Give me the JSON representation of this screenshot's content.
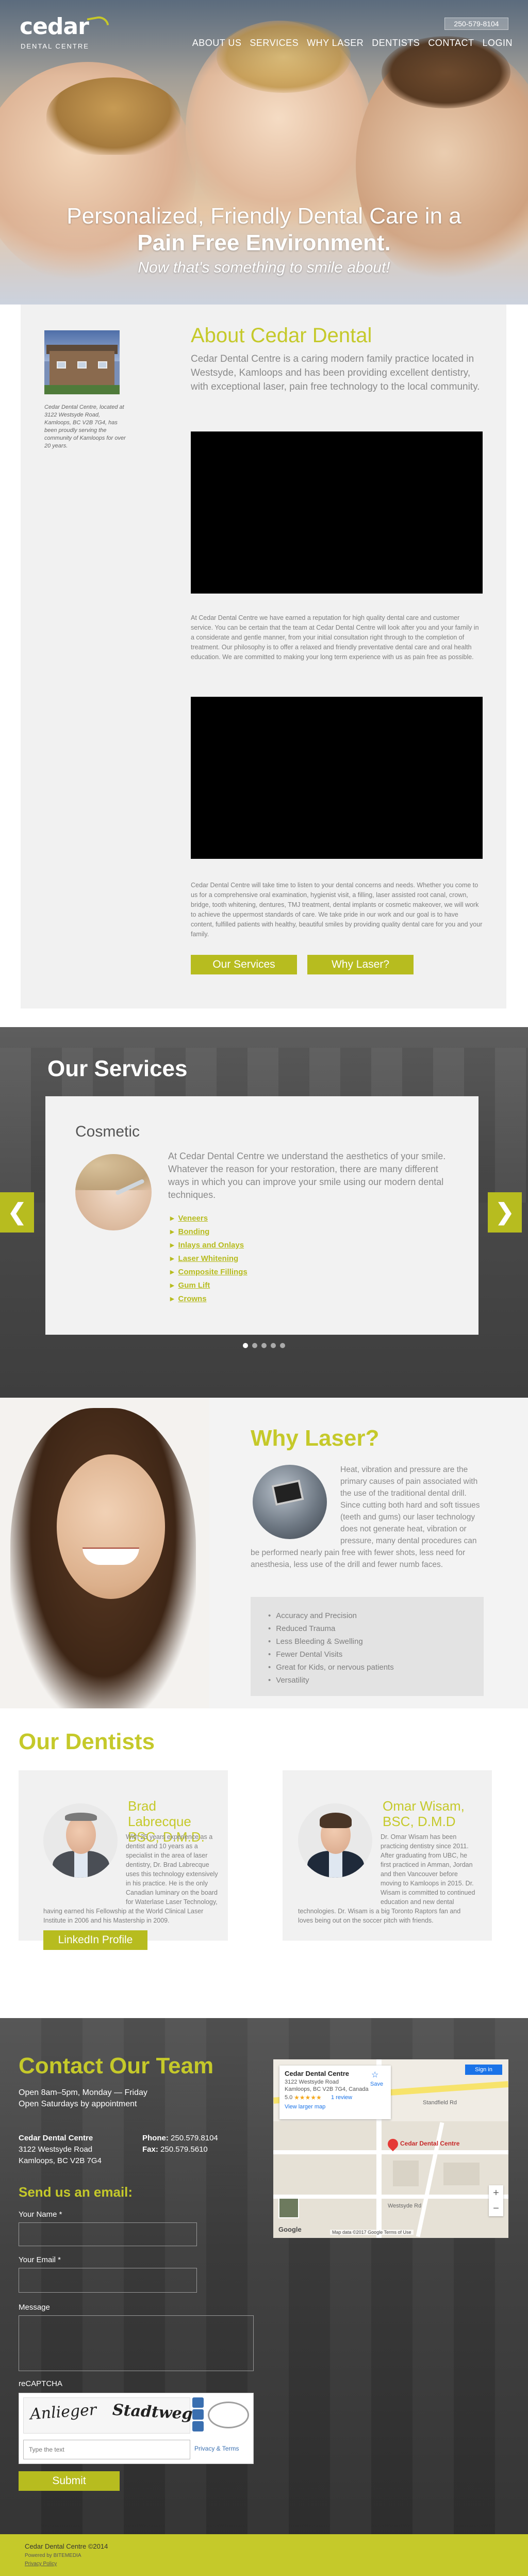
{
  "brand": {
    "logo_text": "cedar",
    "logo_sub": "DENTAL CENTRE",
    "accent": "#c5c92a",
    "button_color": "#b7bc1f"
  },
  "header": {
    "phone": "250-579-8104",
    "nav": [
      "ABOUT US",
      "SERVICES",
      "WHY LASER",
      "DENTISTS",
      "CONTACT",
      "LOGIN"
    ]
  },
  "hero": {
    "line1": "Personalized, Friendly Dental Care in a",
    "line2": "Pain Free Environment.",
    "tagline": "Now that's something to smile about!"
  },
  "about": {
    "title": "About Cedar Dental",
    "lead": "Cedar Dental Centre is a caring modern family practice located in Westsyde, Kamloops and has been providing excellent dentistry, with exceptional laser, pain free technology to the local community.",
    "photo_caption": "Cedar Dental Centre, located at 3122 Westsyde Road, Kamloops, BC V2B 7G4, has been proudly serving the community of Kamloops for over 20 years.",
    "paragraph1": "At Cedar Dental Centre we have earned a reputation for high quality dental care and customer service. You can be certain that the team at Cedar Dental Centre will look after you and your family in a considerate and gentle manner, from your initial consultation right through to the completion of treatment. Our philosophy is to offer a relaxed and friendly preventative dental care and oral health education. We are committed to making your long term experience with us as pain free as possible.",
    "paragraph2": "Cedar Dental Centre will take time to listen to your dental concerns and needs. Whether you come to us for a comprehensive oral examination, hygienist visit, a filling, laser assisted root canal, crown, bridge, tooth whitening, dentures, TMJ treatment, dental implants or cosmetic makeover, we will work to achieve the uppermost standards of care. We take pride in our work and our goal is to have content, fulfilled patients with healthy, beautiful smiles by providing quality dental care for you and your family.",
    "btn_services": "Our Services",
    "btn_laser": "Why Laser?"
  },
  "services": {
    "title": "Our Services",
    "category": "Cosmetic",
    "description": "At Cedar Dental Centre we understand the aesthetics of your smile. Whatever the reason for your restoration, there are many different ways in which you can improve your smile using our modern dental techniques.",
    "items": [
      "Veneers",
      "Bonding",
      "Inlays and Onlays",
      "Laser Whitening",
      "Composite Fillings",
      "Gum Lift",
      "Crowns"
    ],
    "prev": "❮",
    "next": "❯",
    "slide_count": 5,
    "active_slide": 1
  },
  "laser": {
    "title": "Why Laser?",
    "text": "Heat, vibration and pressure are the primary causes of pain associated with the use of the traditional dental drill. Since cutting both hard and soft tissues (teeth and gums) our laser technology does not generate heat, vibration or pressure, many dental procedures can be performed nearly pain free with fewer shots, less need for anesthesia, less use of the drill and fewer numb faces.",
    "benefits": [
      "Accuracy and Precision",
      "Reduced Trauma",
      "Less Bleeding & Swelling",
      "Fewer Dental Visits",
      "Great for Kids, or nervous patients",
      "Versatility"
    ]
  },
  "dentists": {
    "title": "Our Dentists",
    "list": [
      {
        "name": "Brad Labrecque BSC, D.M.D.",
        "bio": "With 25 years experience as a dentist and 10 years as a specialist in the area of laser dentistry, Dr. Brad Labrecque uses this technology extensively in his practice. He is the only Canadian luminary on the board for Waterlase Laser Technology, having earned his Fellowship at the World Clinical Laser Institute in 2006 and his Mastership in 2009.",
        "button": "LinkedIn Profile"
      },
      {
        "name": "Omar Wisam, BSC, D.M.D",
        "bio": "Dr. Omar Wisam has been practicing dentistry since 2011. After graduating from UBC, he first practiced in Amman, Jordan and then Vancouver before moving to Kamloops in 2015. Dr. Wisam is committed to continued education and new dental technologies. Dr. Wisam is a big Toronto Raptors fan and loves being out on the soccer pitch with friends."
      }
    ]
  },
  "contact": {
    "title": "Contact Our Team",
    "hours1": "Open 8am–5pm, Monday — Friday",
    "hours2": "Open Saturdays by appointment",
    "name": "Cedar Dental Centre",
    "address1": "3122 Westsyde Road",
    "address2": "Kamloops, BC V2B 7G4",
    "phone_label": "Phone:",
    "phone": "250.579.8104",
    "fax_label": "Fax:",
    "fax": "250.579.5610",
    "email_title": "Send us an email:",
    "label_name": "Your Name *",
    "label_email": "Your Email *",
    "label_message": "Message",
    "label_captcha": "reCAPTCHA",
    "captcha_word1": "Anlieger",
    "captcha_word2": "Stadtweg",
    "captcha_placeholder": "Type the text",
    "captcha_privacy": "Privacy & Terms",
    "submit": "Submit"
  },
  "map": {
    "place": "Cedar Dental Centre",
    "addr1": "3122 Westsyde Road",
    "addr2": "Kamloops, BC V2B 7G4, Canada",
    "rating": "5.0",
    "stars": "★★★★★",
    "reviews": "1 review",
    "larger_map": "View larger map",
    "save": "Save",
    "sign_in": "Sign in",
    "pin_label": "Cedar Dental Centre",
    "street1": "Standfield Rd",
    "street2": "Westsyde Rd",
    "logo": "Google",
    "credit": "Map data ©2017 Google   Terms of Use",
    "zoom_in": "+",
    "zoom_out": "−"
  },
  "footer": {
    "copy": "Cedar Dental Centre ©2014",
    "powered": "Powered by BITEMEDIA",
    "privacy": "Privacy Policy"
  }
}
